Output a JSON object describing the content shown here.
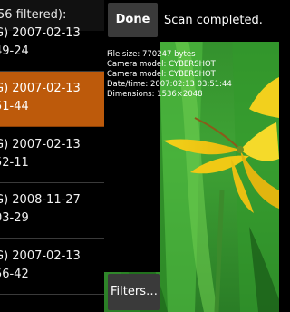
{
  "list": {
    "header": "56 filtered):",
    "rows": [
      {
        "line1": "G) 2007-02-13",
        "line2": "49-24",
        "selected": false
      },
      {
        "line1": "G) 2007-02-13",
        "line2": "51-44",
        "selected": true
      },
      {
        "line1": "G) 2007-02-13",
        "line2": "52-11",
        "selected": false
      },
      {
        "line1": "G) 2008-11-27",
        "line2": "03-29",
        "selected": false
      },
      {
        "line1": "G) 2007-02-13",
        "line2": "56-42",
        "selected": false
      }
    ]
  },
  "toolbar": {
    "done_label": "Done",
    "status": "Scan completed."
  },
  "info": {
    "file_size": "File size: 770247 bytes",
    "camera_model_1": "Camera model: CYBERSHOT",
    "camera_model_2": "Camera model: CYBERSHOT",
    "datetime": "Date/time: 2007:02:13 03:51:44",
    "dimensions": "Dimensions: 1536×2048"
  },
  "filters_label": "Filters…",
  "colors": {
    "selected_row": "#bd5a0b",
    "button_bg": "#3a3a3a"
  }
}
